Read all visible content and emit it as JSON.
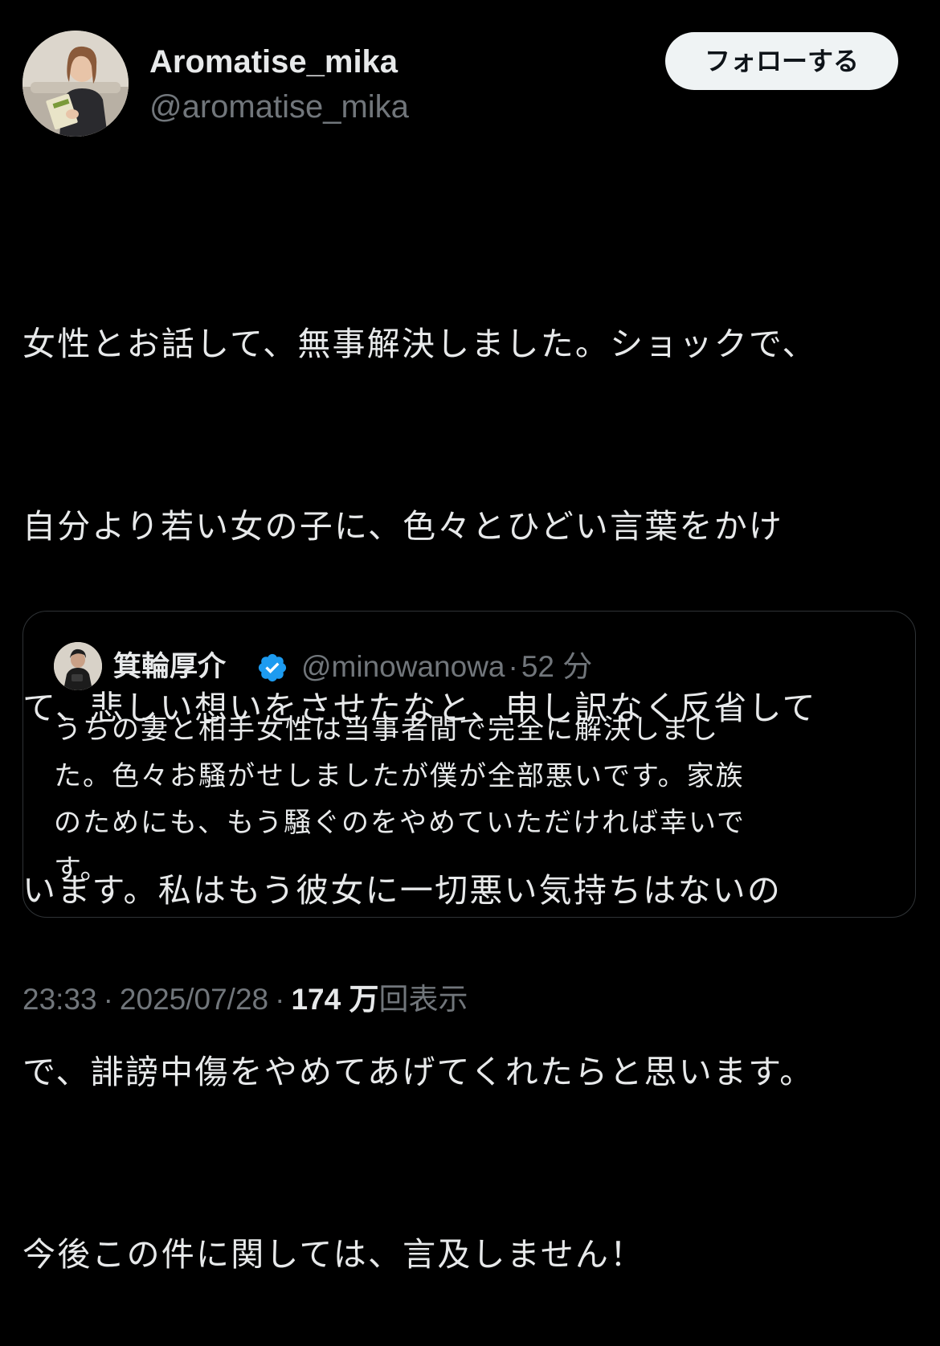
{
  "author": {
    "display_name": "Aromatise_mika",
    "handle": "@aromatise_mika",
    "avatar_icon": "profile-photo-woman-holding-book"
  },
  "follow_button": {
    "label": "フォローする"
  },
  "tweet": {
    "lines": [
      "女性とお話して、無事解決しました。ショックで、",
      "自分より若い女の子に、色々とひどい言葉をかけ",
      "て、悲しい想いをさせたなと、申し訳なく反省して",
      "います。私はもう彼女に一切悪い気持ちはないの",
      "で、誹謗中傷をやめてあげてくれたらと思います。",
      "今後この件に関しては、言及しません！"
    ]
  },
  "quote": {
    "display_name": "箕輪厚介",
    "verified": true,
    "handle": "@minowanowa",
    "time": "52 分",
    "avatar_icon": "profile-photo-man",
    "lines": [
      "うちの妻と相手女性は当事者間で完全に解決しまし",
      "た。色々お騒がせしましたが僕が全部悪いです。家族",
      "のためにも、もう騒ぐのをやめていただければ幸いで",
      "す。"
    ]
  },
  "meta": {
    "time": "23:33",
    "date": "2025/07/28",
    "views_count": "174 万",
    "views_label": "回表示"
  },
  "colors": {
    "background": "#000000",
    "text_primary": "#e7e9ea",
    "text_secondary": "#71767b",
    "verified_blue": "#1d9bf0",
    "border": "#2f3336"
  }
}
